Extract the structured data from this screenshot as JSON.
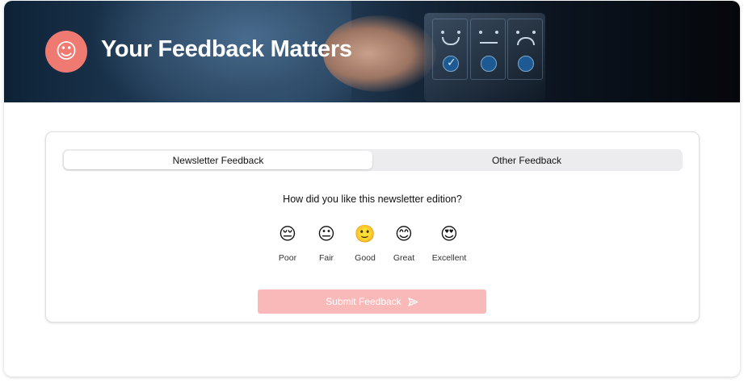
{
  "header": {
    "title": "Your Feedback Matters",
    "logo_icon": "smiley-icon",
    "logo_glyph": "☺",
    "accent_color": "#ee7a72"
  },
  "tabs": [
    {
      "label": "Newsletter Feedback",
      "active": true
    },
    {
      "label": "Other Feedback",
      "active": false
    }
  ],
  "question": "How did you like this newsletter edition?",
  "ratings": [
    {
      "label": "Poor",
      "emoji": "😔"
    },
    {
      "label": "Fair",
      "emoji": "😐"
    },
    {
      "label": "Good",
      "emoji": "🙂"
    },
    {
      "label": "Great",
      "emoji": "😊"
    },
    {
      "label": "Excellent",
      "emoji": "😍"
    }
  ],
  "submit": {
    "label": "Submit Feedback",
    "icon": "send-icon",
    "color": "#f9b9b9"
  }
}
